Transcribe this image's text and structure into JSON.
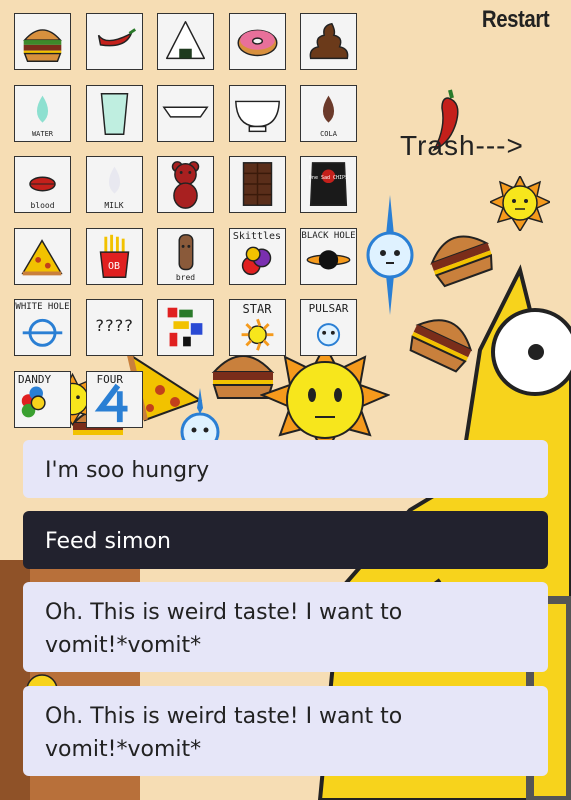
{
  "header": {
    "restart_label": "Restart",
    "trash_label": "Trash--->"
  },
  "food_grid": {
    "items": [
      {
        "icon": "burger-icon",
        "label": ""
      },
      {
        "icon": "chili-pepper-icon",
        "label": ""
      },
      {
        "icon": "onigiri-icon",
        "label": ""
      },
      {
        "icon": "donut-icon",
        "label": ""
      },
      {
        "icon": "poop-icon",
        "label": ""
      },
      {
        "icon": "water-drop-icon",
        "label": "WATER"
      },
      {
        "icon": "empty-glass-icon",
        "label": ""
      },
      {
        "icon": "plate-icon",
        "label": ""
      },
      {
        "icon": "bowl-icon",
        "label": ""
      },
      {
        "icon": "cola-drop-icon",
        "label": "COLA"
      },
      {
        "icon": "blood-lips-icon",
        "label": "blood"
      },
      {
        "icon": "milk-drop-icon",
        "label": "MILK"
      },
      {
        "icon": "teddy-bear-icon",
        "label": ""
      },
      {
        "icon": "chocolate-bar-icon",
        "label": ""
      },
      {
        "icon": "chips-bag-icon",
        "label": "One Sad CHIPS"
      },
      {
        "icon": "pizza-slice-icon",
        "label": ""
      },
      {
        "icon": "fries-icon",
        "label": "OB"
      },
      {
        "icon": "bread-stick-icon",
        "label": "bred"
      },
      {
        "icon": "skittles-icon",
        "label": "Skittles"
      },
      {
        "icon": "black-hole-icon",
        "label": "BLACK HOLE"
      },
      {
        "icon": "white-hole-icon",
        "label": "WHITE HOLE"
      },
      {
        "icon": "question-icon",
        "label": "????"
      },
      {
        "icon": "glitch-icon",
        "label": ""
      },
      {
        "icon": "star-icon",
        "label": "STAR"
      },
      {
        "icon": "pulsar-icon",
        "label": "PULSAR"
      },
      {
        "icon": "dandy-flower-icon",
        "label": "DANDY"
      },
      {
        "icon": "number-four-icon",
        "label": "FOUR"
      }
    ]
  },
  "dialogue": {
    "cards": [
      {
        "text": "I'm soo hungry",
        "style": "light"
      },
      {
        "text": "Feed simon",
        "style": "dark"
      },
      {
        "text": "Oh. This is weird taste! I want to vomit!*vomit*",
        "style": "light"
      },
      {
        "text": "Oh. This is weird taste! I want to vomit!*vomit*",
        "style": "light"
      }
    ]
  },
  "colors": {
    "background": "#f6ddb4",
    "simon_yellow": "#f7d31c",
    "card_light": "#e6e6f8",
    "card_dark": "#22222e"
  }
}
